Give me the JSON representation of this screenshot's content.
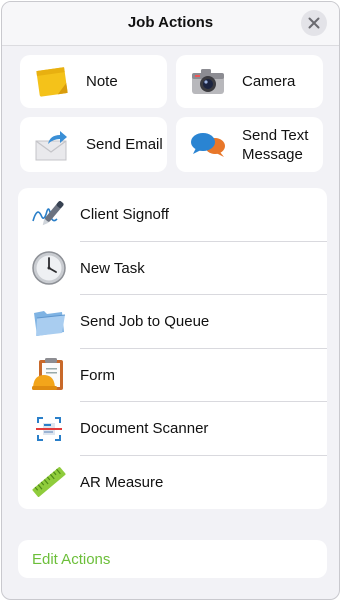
{
  "header": {
    "title": "Job Actions"
  },
  "tiles": [
    {
      "label": "Note",
      "icon": "note-icon"
    },
    {
      "label": "Camera",
      "icon": "camera-icon"
    },
    {
      "label": "Send Email",
      "icon": "email-icon"
    },
    {
      "label": "Send Text Message",
      "icon": "text-message-icon"
    }
  ],
  "list": [
    {
      "label": "Client Signoff",
      "icon": "signature-pen-icon"
    },
    {
      "label": "New Task",
      "icon": "clock-icon"
    },
    {
      "label": "Send Job to Queue",
      "icon": "folder-icon"
    },
    {
      "label": "Form",
      "icon": "hardhat-clipboard-icon"
    },
    {
      "label": "Document Scanner",
      "icon": "scanner-icon"
    },
    {
      "label": "AR Measure",
      "icon": "ruler-icon"
    }
  ],
  "footer": {
    "edit_label": "Edit Actions"
  },
  "colors": {
    "accent": "#6cbf3a",
    "background": "#f2f2f6",
    "card": "#ffffff"
  }
}
